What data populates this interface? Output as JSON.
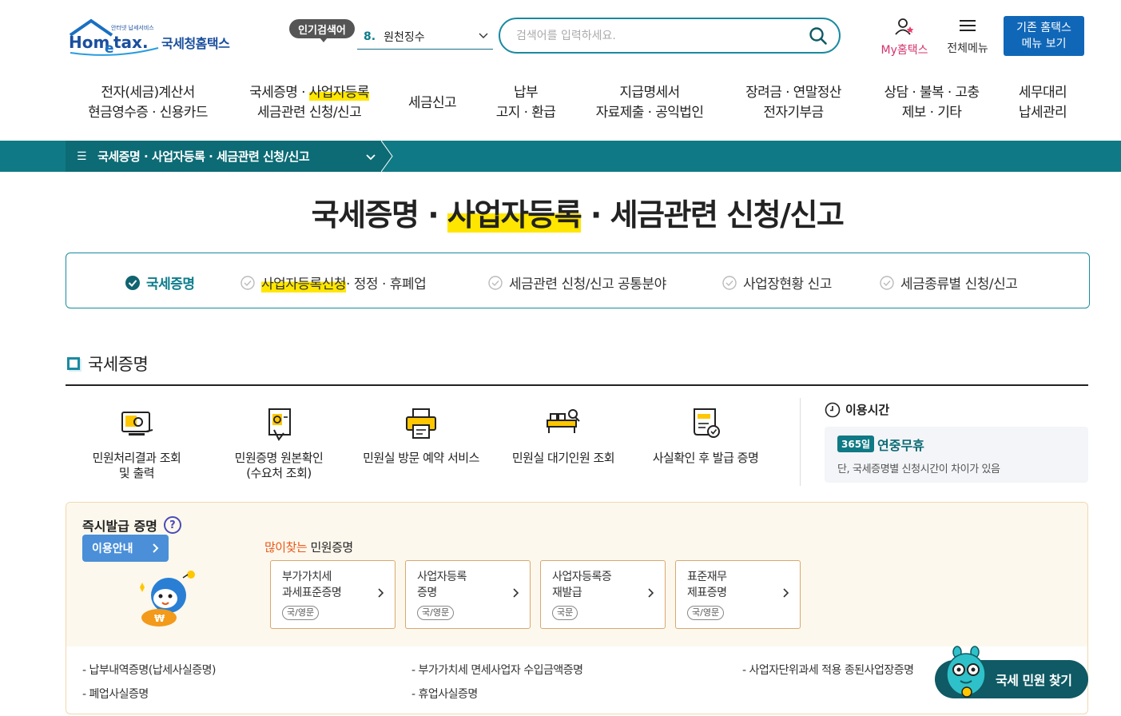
{
  "header": {
    "logo_brand": "Hometax.",
    "logo_tagline": "안터넷 납세서비스",
    "logo_name": "국세청홈택스",
    "popular_badge": "인기검색어",
    "popular_rank": "8.",
    "popular_term": "원천징수",
    "search_placeholder": "검색어를 입력하세요.",
    "my_label": "My홈택스",
    "all_menu_label": "전체메뉴",
    "old_menu_line1": "기존 홈택스",
    "old_menu_line2": "메뉴 보기"
  },
  "gnb": [
    {
      "l1": "전자(세금)계산서",
      "l2": "현금영수증 · 신용카드"
    },
    {
      "l1_a": "국세증명 · ",
      "l1_b": "사업자등록",
      "l2": "세금관련 신청/신고"
    },
    {
      "l1": "세금신고"
    },
    {
      "l1": "납부",
      "l2": "고지 · 환급"
    },
    {
      "l1": "지급명세서",
      "l2": "자료제출 · 공익법인"
    },
    {
      "l1": "장려금 · 연말정산",
      "l2": "전자기부금"
    },
    {
      "l1": "상담 · 불복 · 고충",
      "l2": "제보 · 기타"
    },
    {
      "l1": "세무대리",
      "l2": "납세관리"
    }
  ],
  "breadcrumb": "국세증명 · 사업자등록 · 세금관련 신청/신고",
  "page_title": {
    "a": "국세증명 · ",
    "b": "사업자등록",
    "c": " · 세금관련 신청/신고"
  },
  "tabs": [
    {
      "label": "국세증명"
    },
    {
      "label_a": "사업자등록신청",
      "label_b": " · 정정 · 휴폐업"
    },
    {
      "label": "세금관련 신청/신고 공통분야"
    },
    {
      "label": "사업장현황 신고"
    },
    {
      "label": "세금종류별 신청/신고"
    }
  ],
  "section_title": "국세증명",
  "services": [
    {
      "l1": "민원처리결과 조회",
      "l2": "및 출력",
      "icon": "monitor-result-icon"
    },
    {
      "l1": "민원증명 원본확인",
      "l2": "(수요처 조회)",
      "icon": "document-check-icon"
    },
    {
      "l1": "민원실 방문 예약 서비스",
      "icon": "printer-icon"
    },
    {
      "l1": "민원실 대기인원 조회",
      "icon": "waiting-search-icon"
    },
    {
      "l1": "사실확인 후 발급 증명",
      "icon": "certificate-icon"
    }
  ],
  "usage_time": {
    "heading": "이용시간",
    "days_badge": "365일",
    "value": "연중무휴",
    "note": "단, 국세증명별 신청시간이 차이가 있음"
  },
  "instant": {
    "title": "즉시발급 증명",
    "help": "?",
    "guide_button": "이용안내",
    "popular_em": "많이찾는",
    "popular_rest": " 민원증명",
    "cards": [
      {
        "l1": "부가가치세",
        "l2": "과세표준증명",
        "tag": "국/영문"
      },
      {
        "l1": "사업자등록",
        "l2": "증명",
        "tag": "국/영문"
      },
      {
        "l1": "사업자등록증",
        "l2": "재발급",
        "tag": "국문"
      },
      {
        "l1": "표준재무",
        "l2": "제표증명",
        "tag": "국/영문"
      }
    ],
    "links": [
      "- 납부내역증명(납세사실증명)",
      "- 부가가치세 면세사업자 수입금액증명",
      "- 사업자단위과세 적용 종된사업장증명",
      "- 폐업사실증명",
      "- 휴업사실증명"
    ]
  },
  "finder_button": "국세 민원 찾기",
  "colors": {
    "teal": "#0f7a85",
    "highlight": "#ffe600",
    "blue_button": "#1067b8",
    "pink": "#d6336c"
  }
}
